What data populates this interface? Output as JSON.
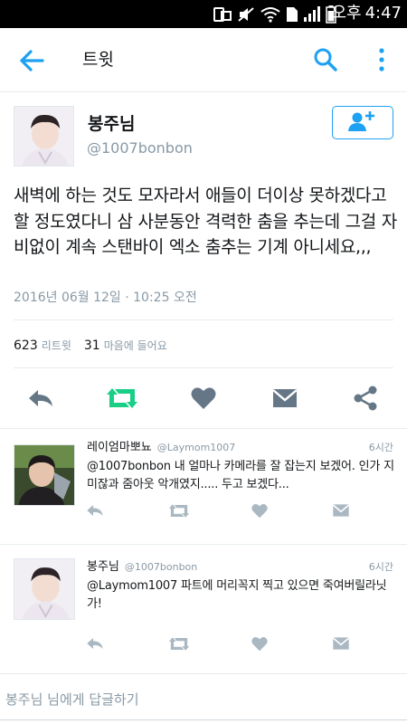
{
  "status_bar": {
    "ampm": "오후",
    "time": "4:47"
  },
  "app_bar": {
    "title": "트윗"
  },
  "tweet": {
    "author_name": "봉주님",
    "author_handle": "@1007bonbon",
    "text": "새벽에 하는 것도 모자라서 애들이 더이상 못하겠다고 할 정도였다니 삼 사분동안 격력한 춤을 추는데 그걸 자비없이 계속 스탠바이 엑소 춤추는 기계 아니세요,,,",
    "date": "2016년 06월 12일 · 10:25 오전",
    "retweet_count": "623",
    "retweet_label": "리트윗",
    "like_count": "31",
    "like_label": "마음에 들어요"
  },
  "replies": [
    {
      "name": "레이엄마뽀뇨",
      "handle": "@Laymom1007",
      "time": "6시간",
      "text": "@1007bonbon 내 얼마나 카메라를 잘 잡는지 보겠어. 인가 지미잖과 줌아웃 악개였지..... 두고 보겠다..."
    },
    {
      "name": "봉주님",
      "handle": "@1007bonbon",
      "time": "6시간",
      "text": "@Laymom1007 파트에 머리꼭지 찍고 있으면 죽여버릴라닛가!"
    }
  ],
  "reply_box": {
    "placeholder": "봉주님 님에게 답글하기"
  },
  "colors": {
    "accent": "#1da1f2",
    "retweet_green": "#19cf86",
    "icon_gray": "#8899a6",
    "text_dark": "#14171a"
  },
  "icons": {
    "back": "arrow-left-icon",
    "search": "search-icon",
    "more": "more-vertical-icon",
    "follow": "follow-person-plus-icon",
    "reply": "reply-icon",
    "retweet": "retweet-icon",
    "like": "heart-icon",
    "dm": "envelope-icon",
    "share": "share-icon"
  }
}
